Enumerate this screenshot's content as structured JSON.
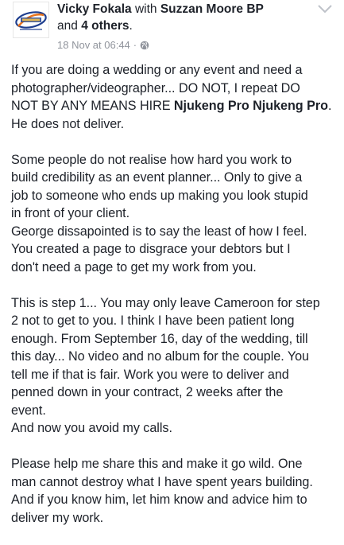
{
  "post": {
    "author": "Vicky Fokala",
    "with_word": "with",
    "tagged": "Suzzan Moore BP",
    "and_word": "and",
    "others": "4 others",
    "period": ".",
    "timestamp": "18 Nov at 06:44",
    "dot": "·",
    "privacy_icon": "globe-icon",
    "menu_icon": "chevron-down-icon"
  },
  "body": {
    "p1": {
      "line1": "If you are doing a wedding or any event and need a",
      "line2": "photographer/videographer... DO NOT, I repeat DO",
      "line3_pre": "NOT BY ANY MEANS HIRE ",
      "line3_mention": "Njukeng Pro Njukeng Pro",
      "line3_post": ".",
      "line4": "He does not deliver."
    },
    "p2": {
      "line1": "Some people do not realise how hard you work to",
      "line2": "build credibility as an event planner... Only to give a",
      "line3": "job to someone who ends up making you look stupid",
      "line4": "in front of your client.",
      "line5": "George dissapointed is to say the least of how I feel.",
      "line6": "You created a page to disgrace your debtors but I",
      "line7": "don't need a page to get my work from you."
    },
    "p3": {
      "line1": "This is step 1... You may only leave Cameroon for step",
      "line2": "2 not to get to you. I think I have been patient long",
      "line3": "enough. From September 16, day of the wedding, till",
      "line4": "this day... No video and no album for the couple. You",
      "line5": "tell me if that is fair. Work you were to deliver and",
      "line6": "penned down in your contract, 2 weeks after the",
      "line7": "event.",
      "line8": "And now you avoid my calls."
    },
    "p4": {
      "line1": "Please help me share this and make it go wild. One",
      "line2": "man cannot destroy what I have spent years building.",
      "line3": "And if you know him,  let him know and advice him to",
      "line4": "deliver my work."
    }
  },
  "colors": {
    "text": "#1d2129",
    "meta": "#90949c",
    "logo_blue": "#1f3f8f",
    "logo_orange": "#e8741d"
  }
}
